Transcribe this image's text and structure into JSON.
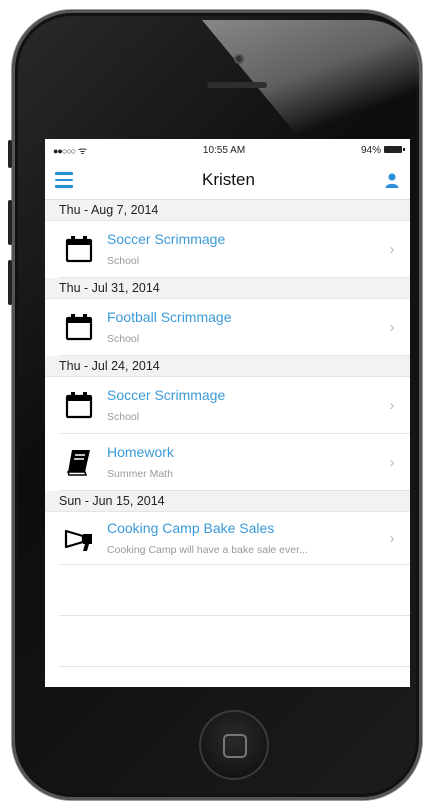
{
  "status_bar": {
    "signal": "●●○○○",
    "wifi": "ᯤ",
    "time": "10:55 AM",
    "battery": "94%"
  },
  "nav": {
    "title": "Kristen",
    "menu_icon": "hamburger-icon",
    "user_icon": "person-icon"
  },
  "sections": [
    {
      "header": "Thu - Aug 7, 2014",
      "items": [
        {
          "title": "Soccer Scrimmage",
          "subtitle": "School",
          "icon": "calendar-icon"
        }
      ]
    },
    {
      "header": "Thu - Jul 31, 2014",
      "items": [
        {
          "title": "Football Scrimmage",
          "subtitle": "School",
          "icon": "calendar-icon"
        }
      ]
    },
    {
      "header": "Thu - Jul 24, 2014",
      "items": [
        {
          "title": "Soccer Scrimmage",
          "subtitle": "School",
          "icon": "calendar-icon"
        },
        {
          "title": "Homework",
          "subtitle": "Summer Math",
          "icon": "book-icon"
        }
      ]
    },
    {
      "header": "Sun - Jun 15, 2014",
      "items": [
        {
          "title": "Cooking Camp Bake Sales",
          "subtitle": "Cooking Camp will have a bake sale ever...",
          "icon": "megaphone-icon"
        }
      ]
    }
  ],
  "chevron": "›",
  "colors": {
    "accent": "#3a9ad9",
    "section_bg": "#f2f2f2"
  }
}
